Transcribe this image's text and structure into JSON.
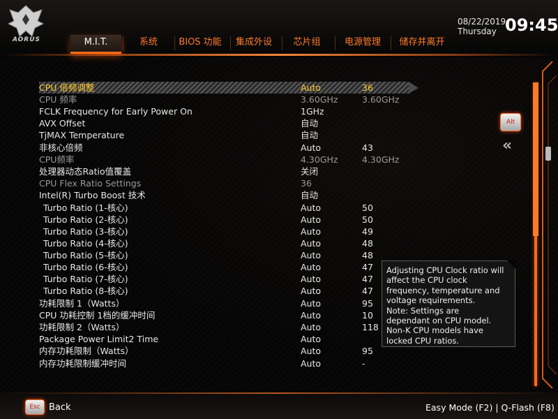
{
  "header": {
    "logo_text": "AORUS",
    "date": "08/22/2019",
    "weekday": "Thursday",
    "time": "09:45",
    "tabs": [
      {
        "label": "M.I.T.",
        "active": true
      },
      {
        "label": "系统"
      },
      {
        "label": "BIOS 功能"
      },
      {
        "label": "集成外设"
      },
      {
        "label": "芯片组"
      },
      {
        "label": "电源管理"
      },
      {
        "label": "储存并离开"
      }
    ]
  },
  "settings": [
    {
      "name": "CPU 倍频调整",
      "value": "Auto",
      "value2": "36"
    },
    {
      "name": "CPU 频率",
      "value": "3.60GHz",
      "value2": "3.60GHz"
    },
    {
      "name": "FCLK Frequency for Early Power On",
      "value": "1GHz",
      "value2": ""
    },
    {
      "name": "AVX Offset",
      "value": "自动",
      "value2": ""
    },
    {
      "name": "TjMAX Temperature",
      "value": "自动",
      "value2": ""
    },
    {
      "name": "非核心倍频",
      "value": "Auto",
      "value2": "43"
    },
    {
      "name": "CPU频率",
      "value": "4.30GHz",
      "value2": "4.30GHz"
    },
    {
      "name": "处理器动态Ratio值覆盖",
      "value": "关闭",
      "value2": ""
    },
    {
      "name": "CPU Flex Ratio Settings",
      "value": "36",
      "value2": ""
    },
    {
      "name": "Intel(R) Turbo Boost 技术",
      "value": "自动",
      "value2": ""
    },
    {
      "name": "Turbo Ratio (1-核心)",
      "value": "Auto",
      "value2": "50"
    },
    {
      "name": "Turbo Ratio (2-核心)",
      "value": "Auto",
      "value2": "50"
    },
    {
      "name": "Turbo Ratio (3-核心)",
      "value": "Auto",
      "value2": "49"
    },
    {
      "name": "Turbo Ratio (4-核心)",
      "value": "Auto",
      "value2": "48"
    },
    {
      "name": "Turbo Ratio (5-核心)",
      "value": "Auto",
      "value2": "48"
    },
    {
      "name": "Turbo Ratio (6-核心)",
      "value": "Auto",
      "value2": "47"
    },
    {
      "name": "Turbo Ratio (7-核心)",
      "value": "Auto",
      "value2": "47"
    },
    {
      "name": "Turbo Ratio (8-核心)",
      "value": "Auto",
      "value2": "47"
    },
    {
      "name": "功耗限制 1（Watts）",
      "value": "Auto",
      "value2": "95"
    },
    {
      "name": "CPU 功耗控制 1档的缓冲时间",
      "value": "Auto",
      "value2": "10"
    },
    {
      "name": "功耗限制 2（Watts）",
      "value": "Auto",
      "value2": "118"
    },
    {
      "name": "Package Power Limit2 Time",
      "value": "Auto",
      "value2": ""
    },
    {
      "name": "内存功耗限制（Watts）",
      "value": "Auto",
      "value2": "95"
    },
    {
      "name": "内存功耗限制缓冲时间",
      "value": "Auto",
      "value2": "-"
    }
  ],
  "help": {
    "lines": [
      "Adjusting CPU Clock ratio will",
      "affect the CPU clock",
      "frequency, temperature and",
      "voltage requirements.",
      "Note: Settings are",
      "dependant  on  CPU model.",
      "Non-K CPU models have",
      "locked CPU ratios."
    ]
  },
  "side": {
    "alt_label": "Alt",
    "collapse_icon": "double-chevron-left-icon"
  },
  "footer": {
    "esc_label": "Esc",
    "back_label": "Back",
    "links": "Easy Mode (F2)  |  Q-Flash (F8)"
  },
  "colors": {
    "accent": "#ff6b17",
    "selected_text": "#ffcc33",
    "dim_text": "#9a9a9a"
  }
}
